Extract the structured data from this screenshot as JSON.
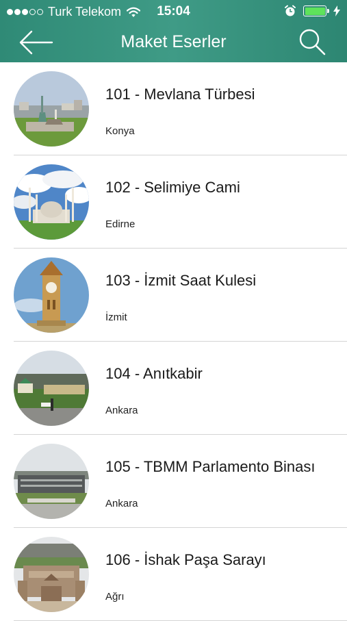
{
  "status_bar": {
    "carrier": "Turk Telekom",
    "time": "15:04",
    "signal_icon": "signal-dots-icon",
    "wifi_icon": "wifi-icon",
    "alarm_icon": "alarm-clock-icon",
    "battery_icon": "battery-charging-icon",
    "battery_color": "#5ee35b"
  },
  "nav": {
    "title": "Maket Eserler",
    "back_icon": "back-arrow-icon",
    "search_icon": "search-icon",
    "header_color": "#3a9580"
  },
  "items": [
    {
      "title": "101 - Mevlana Türbesi",
      "location": "Konya"
    },
    {
      "title": "102 - Selimiye Cami",
      "location": "Edirne"
    },
    {
      "title": "103 - İzmit Saat Kulesi",
      "location": "İzmit"
    },
    {
      "title": "104 - Anıtkabir",
      "location": "Ankara"
    },
    {
      "title": "105 - TBMM Parlamento Binası",
      "location": "Ankara"
    },
    {
      "title": "106 - İshak Paşa Sarayı",
      "location": "Ağrı"
    }
  ]
}
